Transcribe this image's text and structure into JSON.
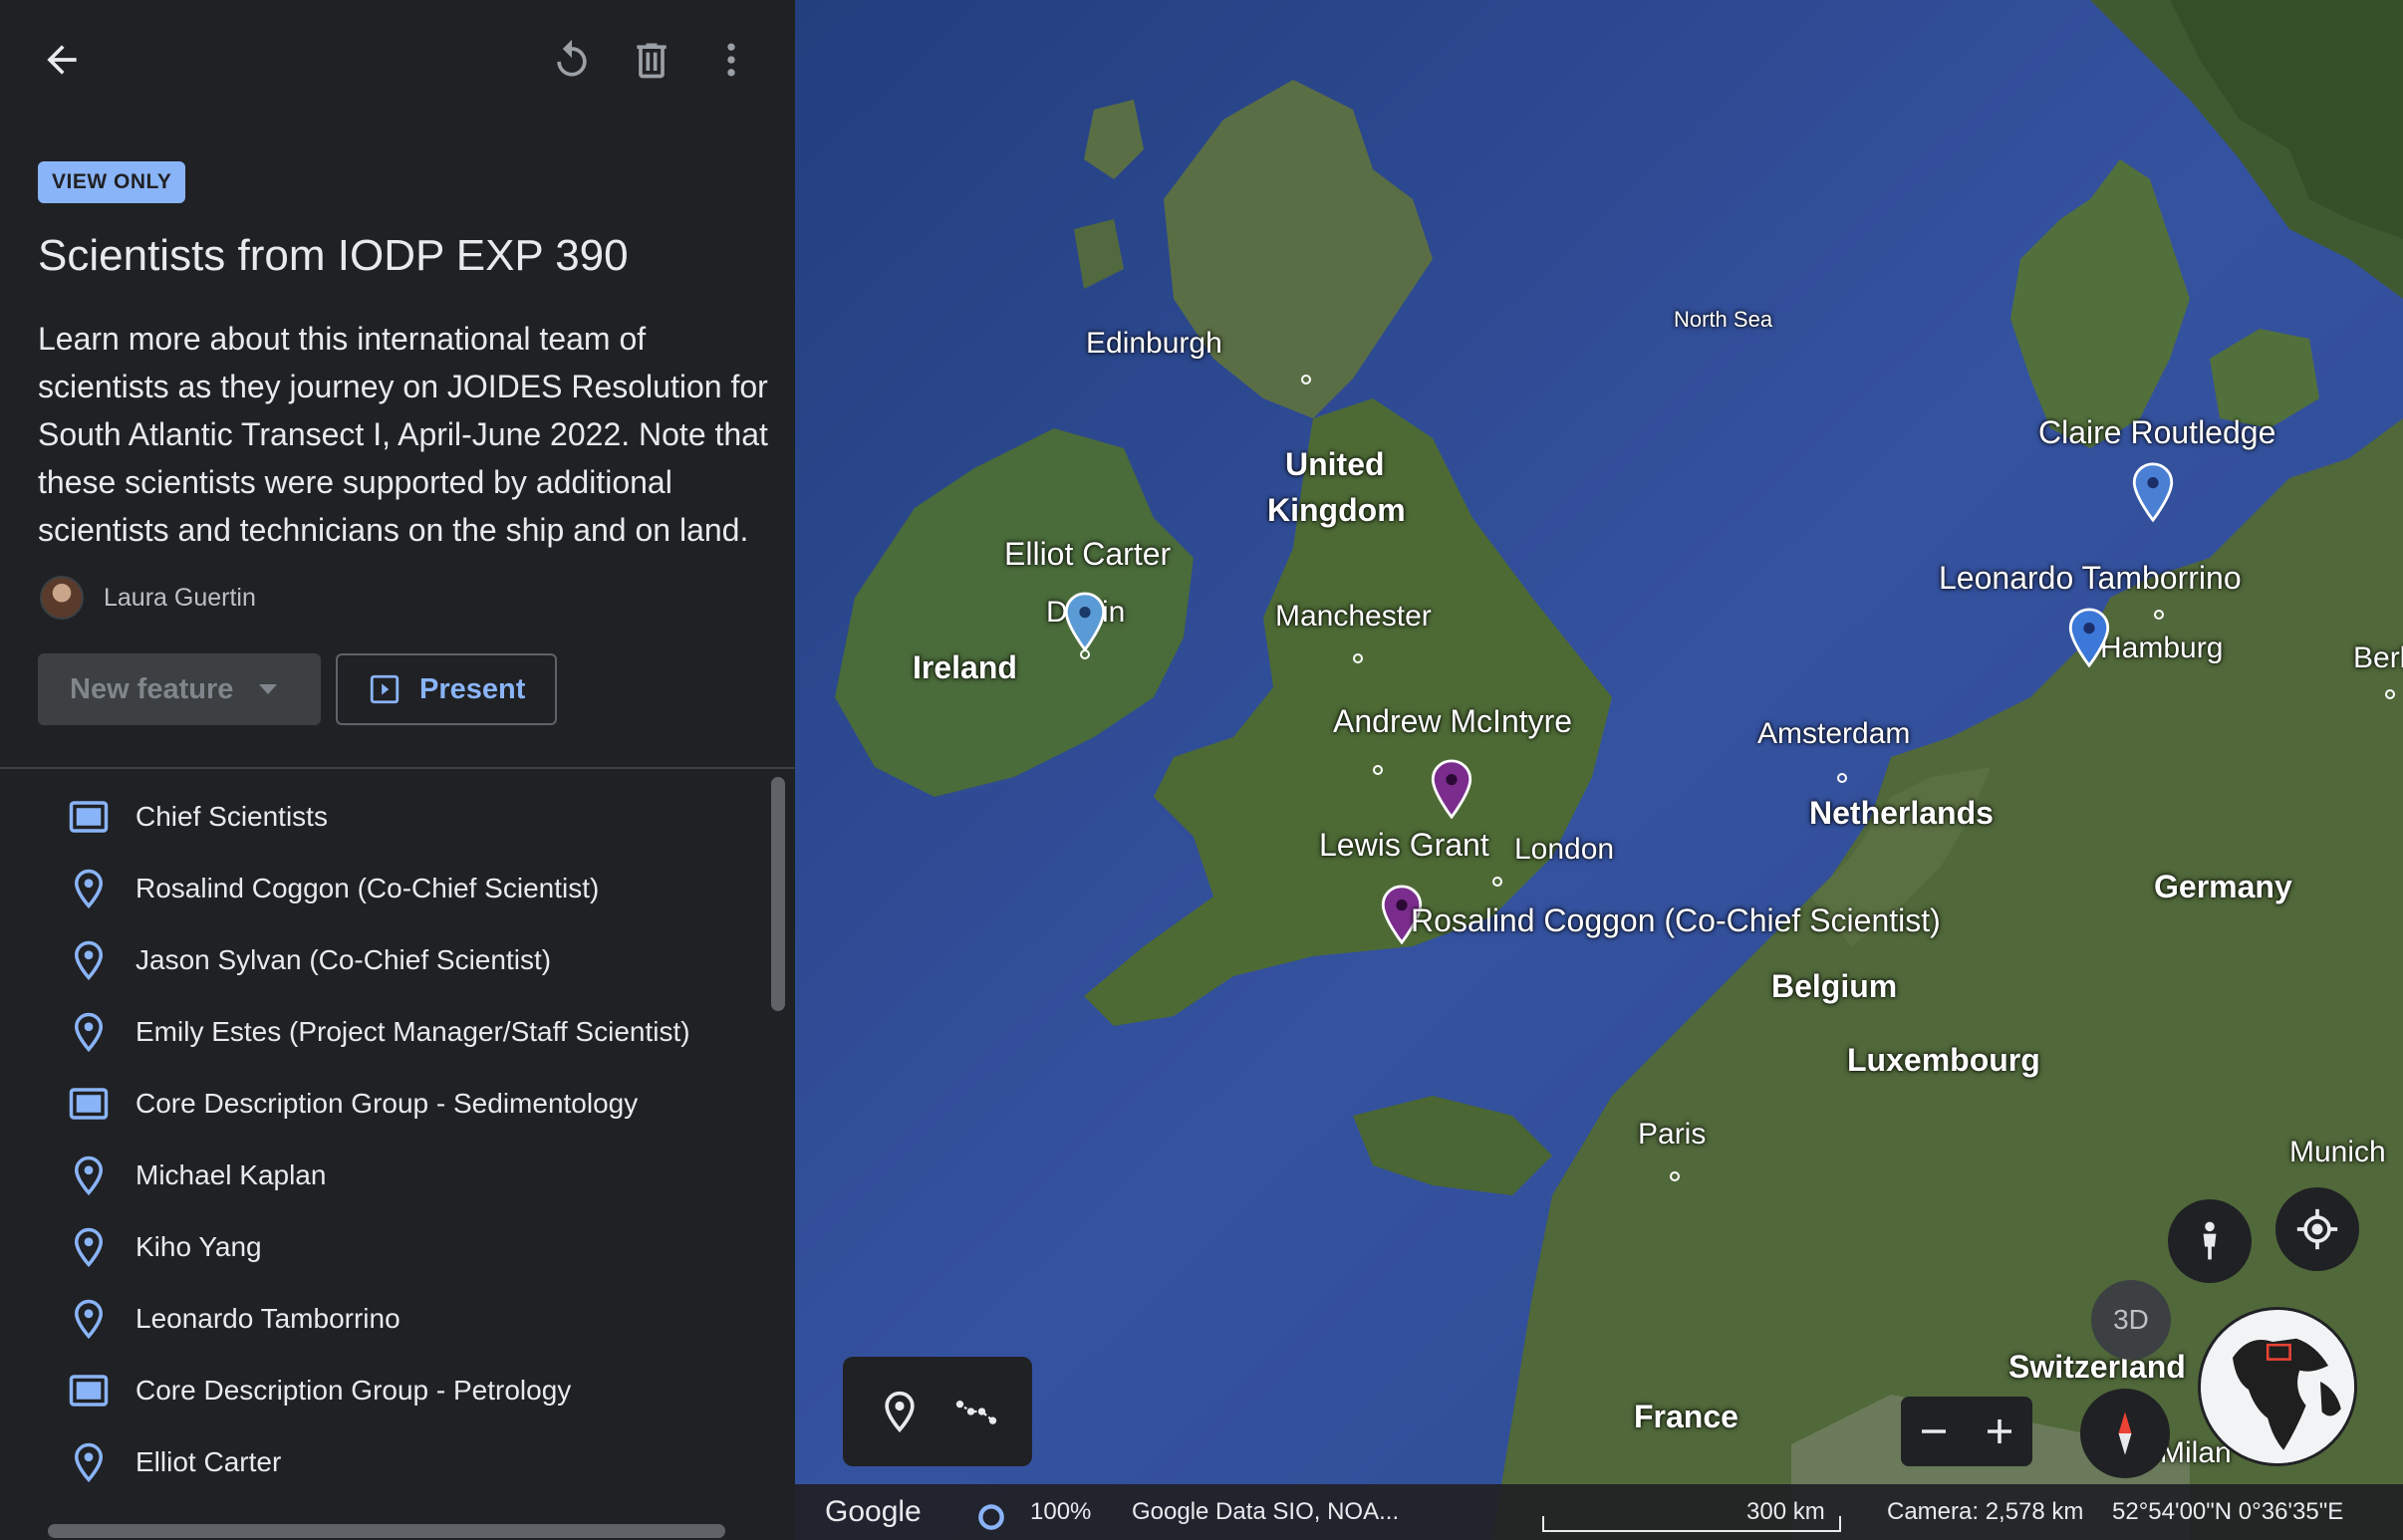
{
  "sidebar": {
    "badge": "VIEW ONLY",
    "title": "Scientists from IODP EXP 390",
    "description": "Learn more about this international team of scientists as they journey on JOIDES Resolution for South Atlantic Transect I, April-June 2022. Note that these scientists were supported by additional scientists and technicians on the ship and on land.",
    "author": "Laura Guertin",
    "new_feature_label": "New feature",
    "present_label": "Present",
    "items": [
      {
        "label": "Chief Scientists",
        "icon": "folder-icon"
      },
      {
        "label": "Rosalind Coggon (Co-Chief Scientist)",
        "icon": "place-icon"
      },
      {
        "label": "Jason Sylvan (Co-Chief Scientist)",
        "icon": "place-icon"
      },
      {
        "label": "Emily Estes (Project Manager/Staff Scientist)",
        "icon": "place-icon"
      },
      {
        "label": "Core Description Group - Sedimentology",
        "icon": "folder-icon"
      },
      {
        "label": "Michael Kaplan",
        "icon": "place-icon"
      },
      {
        "label": "Kiho Yang",
        "icon": "place-icon"
      },
      {
        "label": "Leonardo Tamborrino",
        "icon": "place-icon"
      },
      {
        "label": "Core Description Group - Petrology",
        "icon": "folder-icon"
      },
      {
        "label": "Elliot Carter",
        "icon": "place-icon"
      }
    ]
  },
  "map": {
    "labels": {
      "edinburgh": "Edinburgh",
      "north_sea": "North Sea",
      "united": "United",
      "kingdom": "Kingdom",
      "manchester": "Manchester",
      "ireland": "Ireland",
      "dublin_left": "D",
      "dublin_right": "in",
      "london": "London",
      "amsterdam": "Amsterdam",
      "netherlands": "Netherlands",
      "hamburg": "Hamburg",
      "berlin": "Berl",
      "germany": "Germany",
      "belgium": "Belgium",
      "luxembourg": "Luxembourg",
      "paris": "Paris",
      "munich": "Munich",
      "france": "France",
      "switzerland": "Switzerland",
      "milan": "Milan"
    },
    "placemarks": [
      {
        "name": "Elliot Carter",
        "color": "#5b9bd5"
      },
      {
        "name": "Claire Routledge",
        "color": "#4a7fd4"
      },
      {
        "name": "Leonardo Tamborrino",
        "color": "#3b78d8"
      },
      {
        "name": "Andrew McIntyre",
        "color": "#7b2d8e"
      },
      {
        "name": "Lewis Grant",
        "color": "#7b2d8e"
      },
      {
        "name": "Rosalind Coggon (Co-Chief Scientist)",
        "color": "#7b2d8e"
      }
    ],
    "btn_3d": "3D",
    "status": {
      "logo": "Google",
      "opacity": "100%",
      "attribution": "Google   Data SIO, NOA...",
      "scale": "300 km",
      "camera": "Camera: 2,578 km",
      "coords": "52°54'00\"N 0°36'35\"E"
    }
  },
  "colors": {
    "accent": "#8ab4f8",
    "sidebar_bg": "#202124",
    "purple_pin": "#7b2d8e",
    "blue_pin": "#4a7fd4"
  }
}
